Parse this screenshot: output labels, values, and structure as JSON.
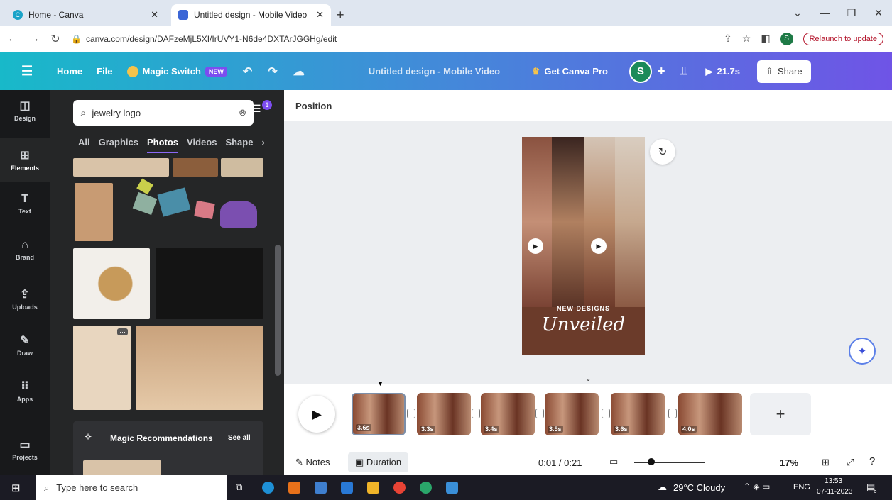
{
  "browser": {
    "tabs": [
      {
        "title": "Home - Canva",
        "active": false
      },
      {
        "title": "Untitled design - Mobile Video",
        "active": true
      }
    ],
    "url": "canva.com/design/DAFzeMjL5XI/IrUVY1-N6de4DXTArJGGHg/edit",
    "profile_initial": "S",
    "relaunch": "Relaunch to update"
  },
  "topbar": {
    "home": "Home",
    "file": "File",
    "magic_switch": "Magic Switch",
    "new_badge": "NEW",
    "doc_title": "Untitled design - Mobile Video",
    "get_pro": "Get Canva Pro",
    "avatar": "S",
    "play_time": "21.7s",
    "share": "Share"
  },
  "rail": [
    "Design",
    "Elements",
    "Text",
    "Brand",
    "Uploads",
    "Draw",
    "Apps",
    "Projects"
  ],
  "panel": {
    "search_value": "jewelry logo",
    "filter_count": "1",
    "categories": [
      "All",
      "Graphics",
      "Photos",
      "Videos",
      "Shape"
    ],
    "active_category": "Photos",
    "magic_title": "Magic Recommendations",
    "see_all": "See all"
  },
  "editor": {
    "position_label": "Position",
    "design_line1": "NEW DESIGNS",
    "design_line2": "Unveiled"
  },
  "timeline": {
    "clips": [
      "3.6s",
      "3.3s",
      "3.4s",
      "3.5s",
      "3.6s",
      "4.0s"
    ]
  },
  "bottombar": {
    "notes": "Notes",
    "duration": "Duration",
    "timecode": "0:01 / 0:21",
    "zoom": "17%"
  },
  "taskbar": {
    "search_placeholder": "Type here to search",
    "weather": "29°C Cloudy",
    "lang": "ENG",
    "time": "13:53",
    "date": "07-11-2023",
    "notif_count": "6"
  },
  "colors": {
    "accent_purple": "#7c4df0",
    "topbar_start": "#18b9c9",
    "topbar_end": "#6f54e6"
  }
}
